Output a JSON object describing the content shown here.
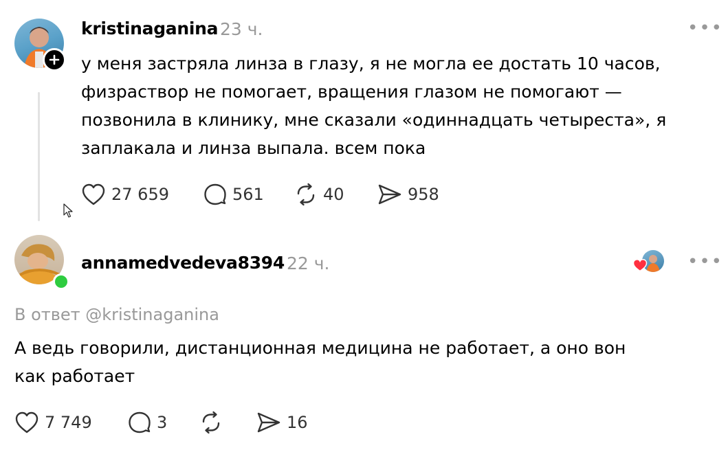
{
  "post": {
    "username": "kristinaganina",
    "time": "23 ч.",
    "text_lines": [
      "у меня застряла линза в глазу, я не могла ее достать 10 часов,",
      "физраствор не помогает, вращения глазом не помогают —",
      "позвонила в клинику, мне сказали «одиннадцать четыреста», я",
      "заплакала и линза выпала. всем пока"
    ],
    "likes": "27 659",
    "comments": "561",
    "reposts": "40",
    "shares": "958",
    "more_label": "•••"
  },
  "reply": {
    "username": "annamedvedeva8394",
    "time": "22 ч.",
    "reply_to": "В ответ @kristinaganina",
    "text_lines": [
      "А ведь говорили, дистанционная медицина не работает, а оно вон",
      "как работает"
    ],
    "likes": "7 749",
    "comments": "3",
    "shares": "16",
    "more_label": "•••"
  },
  "colors": {
    "online": "#2ecc40",
    "heart_badge": "#ff3040",
    "muted": "#999999"
  }
}
